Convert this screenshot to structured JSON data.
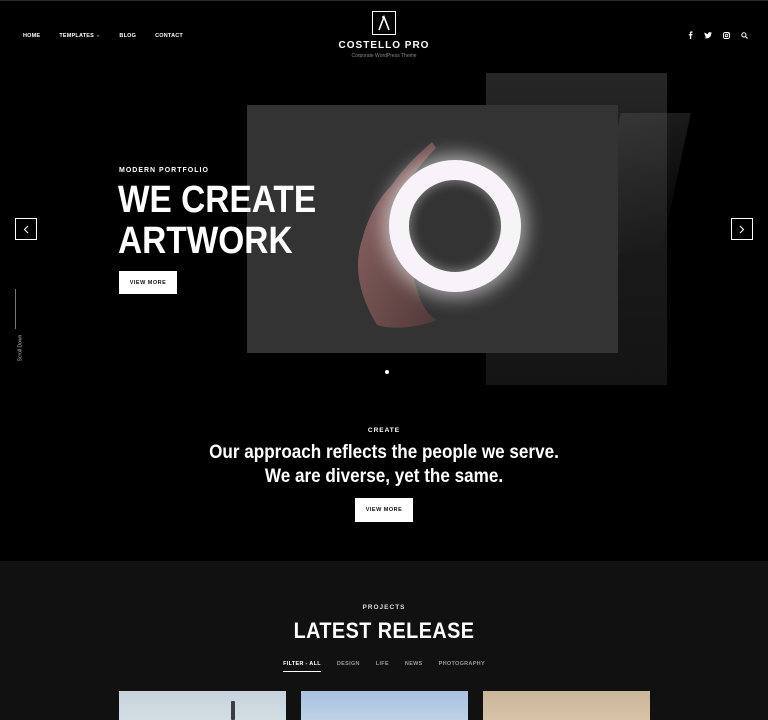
{
  "header": {
    "nav": [
      {
        "label": "HOME"
      },
      {
        "label": "TEMPLATES",
        "has_dropdown": true
      },
      {
        "label": "BLOG"
      },
      {
        "label": "CONTACT"
      }
    ],
    "logo": {
      "title": "COSTELLO PRO",
      "subtitle": "Corporate WordPress Theme"
    },
    "social_icons": [
      "facebook-icon",
      "twitter-icon",
      "instagram-icon",
      "search-icon"
    ]
  },
  "hero": {
    "eyebrow": "MODERN PORTFOLIO",
    "title_line1": "WE CREATE",
    "title_line2": "ARTWORK",
    "button": "VIEW MORE",
    "scroll_label": "Scroll Down"
  },
  "approach": {
    "eyebrow": "CREATE",
    "line1": "Our approach reflects the people we serve.",
    "line2": "We are diverse, yet the same.",
    "button": "VIEW MORE"
  },
  "projects": {
    "eyebrow": "PROJECTS",
    "title": "LATEST RELEASE",
    "filters": [
      "FILTER - ALL",
      "DESIGN",
      "LIFE",
      "NEWS",
      "PHOTOGRAPHY"
    ],
    "active_filter": "FILTER - ALL"
  },
  "colors": {
    "background": "#000000",
    "section_bg": "#111111",
    "accent": "#ffffff"
  }
}
